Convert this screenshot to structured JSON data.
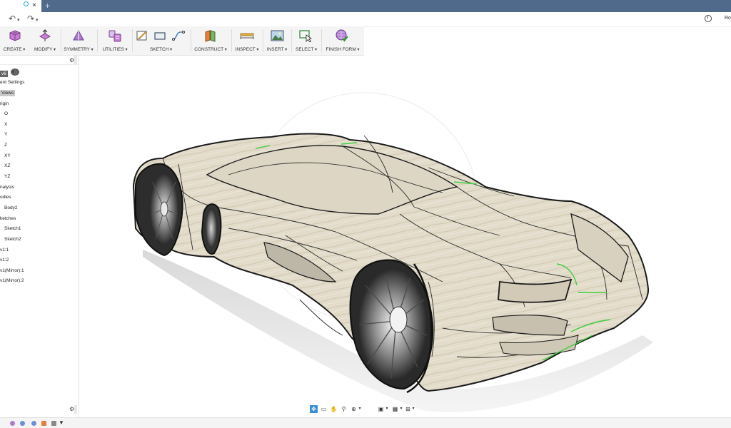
{
  "window": {
    "new_tab": "+",
    "close_tab": "×"
  },
  "quick_access": {
    "undo": "↶",
    "redo": "↷",
    "user_initial": "Ro"
  },
  "toolbar": {
    "groups": [
      {
        "id": "create",
        "label": "CREATE"
      },
      {
        "id": "modify",
        "label": "MODIFY"
      },
      {
        "id": "symmetry",
        "label": "SYMMETRY"
      },
      {
        "id": "utilities",
        "label": "UTILITIES"
      },
      {
        "id": "sketch",
        "label": "SKETCH"
      },
      {
        "id": "construct",
        "label": "CONSTRUCT"
      },
      {
        "id": "inspect",
        "label": "INSPECT"
      },
      {
        "id": "insert",
        "label": "INSERT"
      },
      {
        "id": "select",
        "label": "SELECT"
      },
      {
        "id": "finish_form",
        "label": "FINISH FORM"
      }
    ]
  },
  "browser": {
    "items": [
      {
        "label": "v6"
      },
      {
        "label": "ent Settings"
      },
      {
        "label": "Views"
      },
      {
        "label": "rigin"
      },
      {
        "label": "O"
      },
      {
        "label": "X"
      },
      {
        "label": "Y"
      },
      {
        "label": "Z"
      },
      {
        "label": "XY"
      },
      {
        "label": "XZ"
      },
      {
        "label": "YZ"
      },
      {
        "label": "nalysis"
      },
      {
        "label": "odies"
      },
      {
        "label": "Body2"
      },
      {
        "label": "ketches"
      },
      {
        "label": "Sketch1"
      },
      {
        "label": "Sketch2"
      },
      {
        "label": "v1:1"
      },
      {
        "label": "v1:2"
      },
      {
        "label": "v1(Mirror):1"
      },
      {
        "label": "v1(Mirror):2"
      }
    ]
  },
  "colors": {
    "title_bar": "#4f6a8a",
    "body_surface": "#e3dccb",
    "edge_lines": "#1a1a1a",
    "selected_edges": "#3ecf3e",
    "nav_active": "#3b8fd6"
  },
  "icons": {
    "create": "cube-icon",
    "modify": "modify-icon",
    "symmetry": "symmetry-icon",
    "utilities": "utilities-icon",
    "sketch": "sketch-icon",
    "construct": "plane-icon",
    "inspect": "measure-icon",
    "insert": "image-icon",
    "select": "select-icon",
    "finish_form": "finish-form-icon"
  }
}
